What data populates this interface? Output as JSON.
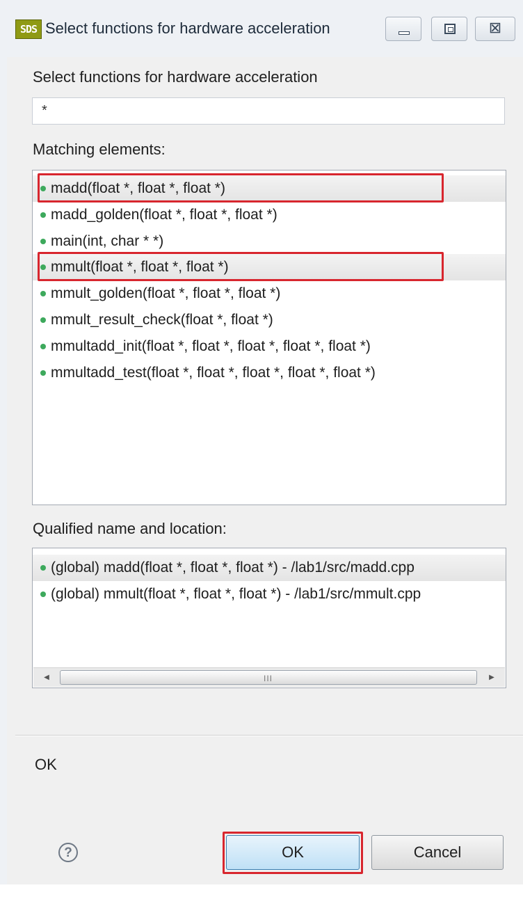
{
  "window": {
    "app_icon_text": "SDS",
    "title": "Select functions for hardware acceleration",
    "minimize_icon": "minimize-icon",
    "maximize_icon": "maximize-icon",
    "close_icon": "close-icon",
    "close_glyph": "⊠"
  },
  "dialog": {
    "header": "Select functions for hardware acceleration",
    "filter": {
      "value": "*",
      "placeholder": ""
    },
    "matching_label": "Matching elements:",
    "matching_items": [
      {
        "text": "madd(float *, float *, float *)",
        "selected": true,
        "highlighted": true
      },
      {
        "text": "madd_golden(float *, float *, float *)",
        "selected": false,
        "highlighted": false
      },
      {
        "text": "main(int, char * *)",
        "selected": false,
        "highlighted": false
      },
      {
        "text": "mmult(float *, float *, float *)",
        "selected": true,
        "highlighted": true
      },
      {
        "text": "mmult_golden(float *, float *, float *)",
        "selected": false,
        "highlighted": false
      },
      {
        "text": "mmult_result_check(float *, float *)",
        "selected": false,
        "highlighted": false
      },
      {
        "text": "mmultadd_init(float *, float *, float *, float *, float *)",
        "selected": false,
        "highlighted": false
      },
      {
        "text": "mmultadd_test(float *, float *, float *, float *, float *)",
        "selected": false,
        "highlighted": false
      }
    ],
    "qualified_label": "Qualified name and location:",
    "qualified_items": [
      {
        "text": "(global) madd(float *, float *, float *) - /lab1/src/madd.cpp",
        "selected": true
      },
      {
        "text": "(global) mmult(float *, float *, float *) - /lab1/src/mmult.cpp",
        "selected": false
      }
    ],
    "scrollbar": {
      "left_arrow": "◀",
      "right_arrow": "▶",
      "grip": "III"
    },
    "status_text": "OK"
  },
  "footer": {
    "help_icon": "help-icon",
    "help_glyph": "?",
    "ok_label": "OK",
    "cancel_label": "Cancel"
  },
  "colors": {
    "accent_highlight": "#d8262e",
    "bullet": "#3da95c",
    "ok_button_border": "#3c7fb1"
  }
}
